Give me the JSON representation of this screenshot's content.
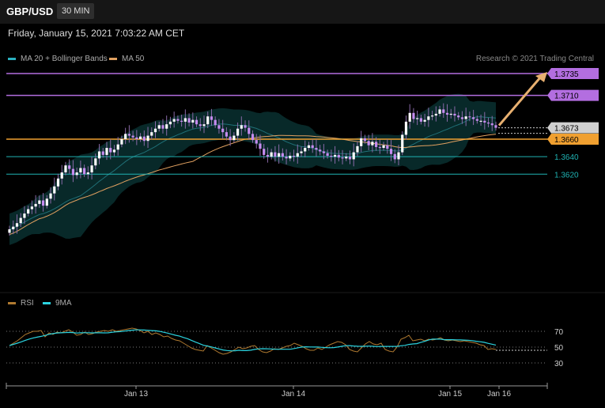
{
  "header": {
    "symbol": "GBP/USD",
    "timeframe": "30 MIN"
  },
  "date_text": "Friday, January 15, 2021 7:03:22 AM CET",
  "credit": "Research © 2021 Trading Central",
  "colors": {
    "bull": "#ffffff",
    "bear": "#c58cf0",
    "ma20": "#2bb1c0",
    "ma50": "#e0a060",
    "resistance": "#b36ee0",
    "support_orange": "#f0a030",
    "support_teal": "#1fb3b3",
    "rsi": "#b07a30",
    "rsi_ma": "#2bd4e0",
    "arrow": "#e8b070"
  },
  "chart_data": [
    {
      "type": "candlestick",
      "title": "GBP/USD",
      "legend": [
        {
          "name": "MA 20 + Bollinger Bands",
          "color": "#2bb1c0"
        },
        {
          "name": "MA 50",
          "color": "#e0a060"
        }
      ],
      "x_ticks": [
        "Jan 13",
        "Jan 14",
        "Jan 15",
        "Jan 16"
      ],
      "ylim": [
        1.3535,
        1.3745
      ],
      "last_price": 1.3673,
      "levels": [
        {
          "value": 1.3735,
          "label": "1.3735",
          "kind": "target"
        },
        {
          "value": 1.371,
          "label": "1.3710",
          "kind": "resistance"
        },
        {
          "value": 1.3673,
          "label": "1.3673",
          "kind": "last"
        },
        {
          "value": 1.366,
          "label": "1.3660",
          "kind": "pivot"
        },
        {
          "value": 1.364,
          "label": "1.3640",
          "kind": "support"
        },
        {
          "value": 1.362,
          "label": "1.3620",
          "kind": "support"
        }
      ],
      "close": [
        1.3557,
        1.356,
        1.3564,
        1.357,
        1.3575,
        1.358,
        1.3583,
        1.3586,
        1.359,
        1.3584,
        1.3592,
        1.3598,
        1.3606,
        1.3615,
        1.3622,
        1.363,
        1.3626,
        1.3619,
        1.3622,
        1.3627,
        1.362,
        1.3622,
        1.363,
        1.3638,
        1.3646,
        1.3642,
        1.365,
        1.3645,
        1.3648,
        1.3654,
        1.366,
        1.3666,
        1.3664,
        1.3662,
        1.366,
        1.3663,
        1.3658,
        1.3664,
        1.3668,
        1.3672,
        1.3676,
        1.3672,
        1.3677,
        1.368,
        1.3683,
        1.3681,
        1.368,
        1.3684,
        1.3679,
        1.3682,
        1.3677,
        1.3675,
        1.3677,
        1.3686,
        1.3682,
        1.3676,
        1.3672,
        1.3668,
        1.3663,
        1.3659,
        1.3664,
        1.3672,
        1.3676,
        1.3673,
        1.3666,
        1.3659,
        1.3655,
        1.3649,
        1.3642,
        1.364,
        1.3645,
        1.364,
        1.3644,
        1.364,
        1.3638,
        1.3641,
        1.364,
        1.3644,
        1.3646,
        1.365,
        1.3653,
        1.365,
        1.3648,
        1.3646,
        1.3644,
        1.3641,
        1.364,
        1.3642,
        1.3639,
        1.3638,
        1.364,
        1.3637,
        1.3645,
        1.3652,
        1.3661,
        1.3658,
        1.3653,
        1.3657,
        1.3651,
        1.365,
        1.3653,
        1.3649,
        1.3643,
        1.3637,
        1.3645,
        1.3665,
        1.368,
        1.369,
        1.3683,
        1.3684,
        1.368,
        1.3682,
        1.3686,
        1.3687,
        1.3689,
        1.3694,
        1.369,
        1.3688,
        1.3689,
        1.3687,
        1.3685,
        1.3683,
        1.3686,
        1.3685,
        1.3683,
        1.3681,
        1.3681,
        1.3679,
        1.3678,
        1.3676,
        1.3673
      ],
      "rsi": {
        "name": "RSI",
        "ma_name": "9MA",
        "levels": [
          70,
          50,
          30
        ],
        "values": [
          52,
          55,
          58,
          62,
          66,
          68,
          70,
          70,
          71,
          63,
          68,
          66,
          69,
          68,
          70,
          72,
          69,
          65,
          66,
          69,
          66,
          67,
          69,
          70,
          71,
          70,
          72,
          70,
          71,
          72,
          73,
          74,
          73,
          71,
          68,
          70,
          66,
          68,
          66,
          63,
          64,
          61,
          59,
          58,
          55,
          52,
          49,
          47,
          46,
          45,
          52,
          49,
          46,
          43,
          41,
          42,
          44,
          47,
          50,
          48,
          49,
          51,
          52,
          47,
          44,
          43,
          45,
          48,
          47,
          49,
          51,
          52,
          55,
          53,
          51,
          48,
          46,
          46,
          49,
          47,
          50,
          53,
          55,
          57,
          56,
          53,
          47,
          45,
          44,
          49,
          54,
          57,
          54,
          53,
          55,
          47,
          45,
          44,
          50,
          60,
          62,
          65,
          58,
          59,
          60,
          58,
          60,
          59,
          60,
          62,
          59,
          58,
          59,
          58,
          57,
          58,
          57,
          56,
          55,
          53,
          52,
          47,
          48,
          47
        ]
      }
    }
  ]
}
